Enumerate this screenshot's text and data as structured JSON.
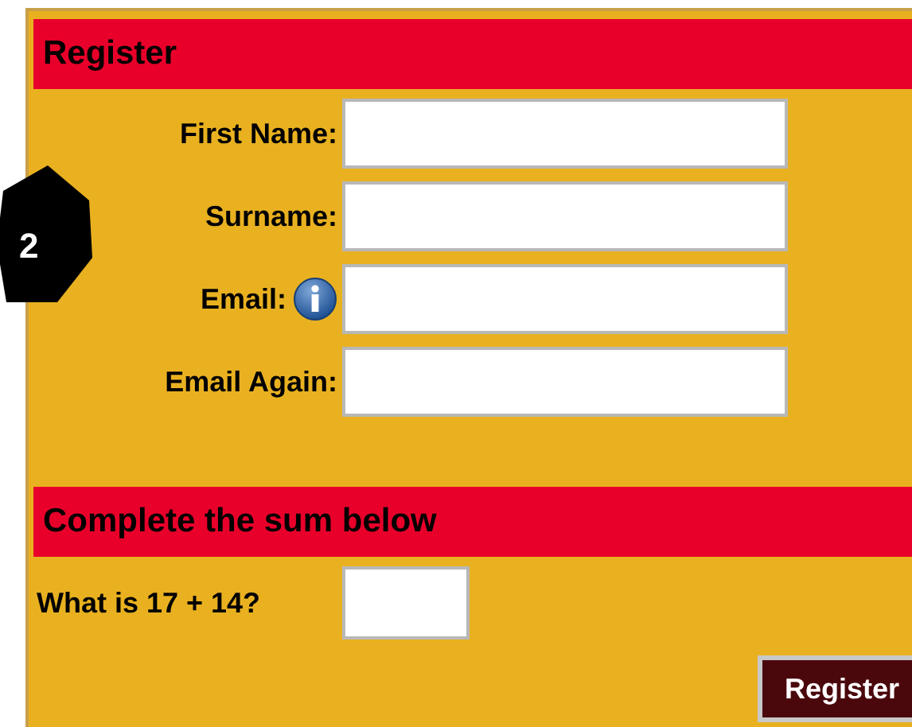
{
  "badge": "2",
  "register_section": {
    "title": "Register",
    "fields": [
      {
        "label": "First Name:"
      },
      {
        "label": "Surname:"
      },
      {
        "label": "Email:",
        "info_icon": true
      },
      {
        "label": "Email Again:"
      }
    ]
  },
  "sum_section": {
    "title": "Complete the sum below",
    "question": "What is 17 + 14?"
  },
  "submit_button": "Register"
}
